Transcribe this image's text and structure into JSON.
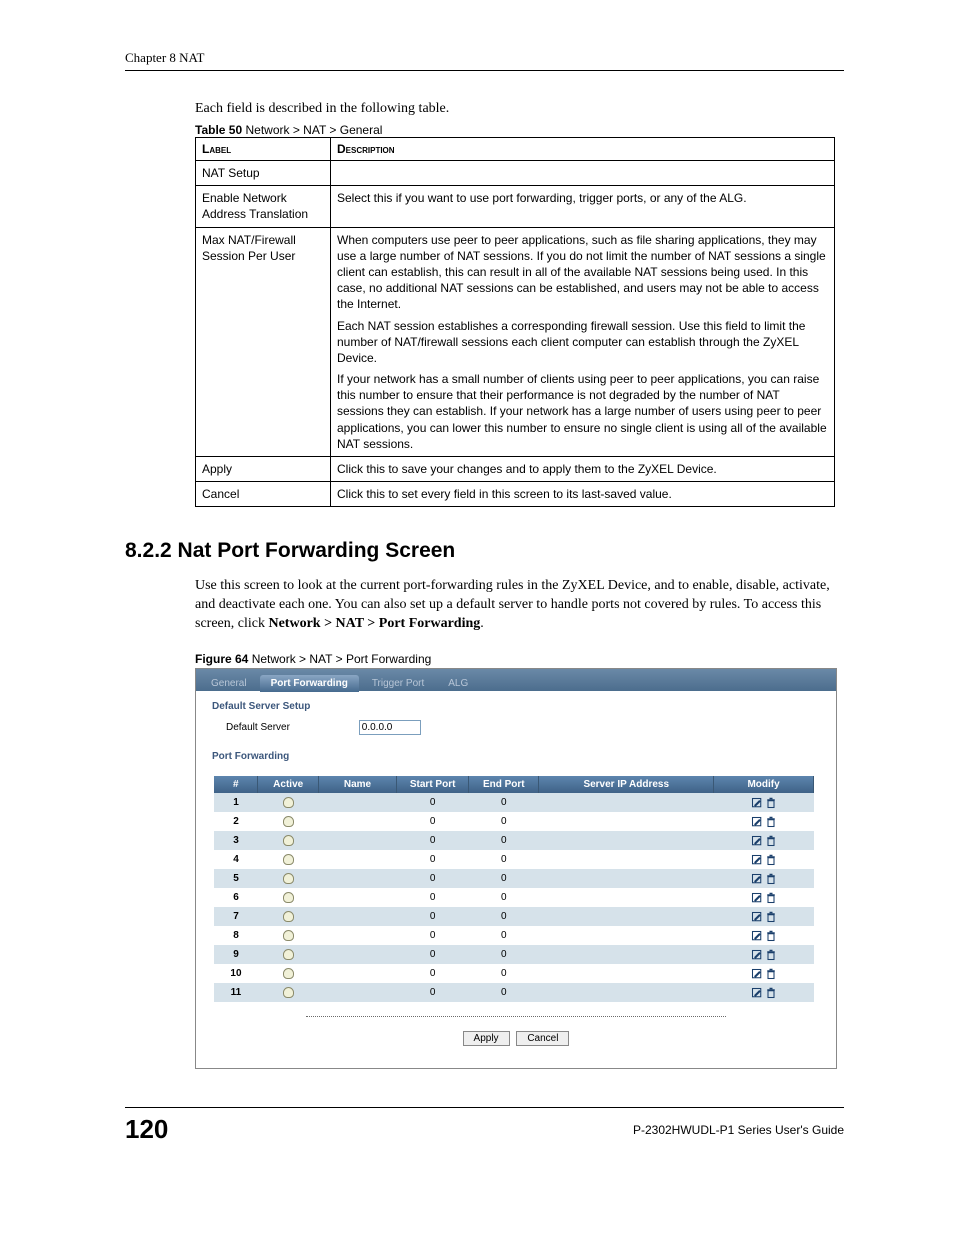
{
  "chapter_header": "Chapter 8 NAT",
  "intro": "Each field is described in the following table.",
  "table50": {
    "caption_bold": "Table 50",
    "caption_rest": "   Network > NAT > General",
    "head_label": "Label",
    "head_desc": "Description",
    "rows": [
      {
        "label": "NAT Setup",
        "desc": ""
      },
      {
        "label": "Enable Network Address Translation",
        "desc": "Select this if you want to use port forwarding, trigger ports, or any of the ALG."
      },
      {
        "label": "Max NAT/Firewall Session Per User",
        "p1": "When computers use peer to peer applications, such as file sharing applications, they may use a large number of NAT sessions. If you do not limit the number of NAT sessions a single client can establish, this can result in all of the available NAT sessions being used. In this case, no additional NAT sessions can be established, and users may not be able to access the Internet.",
        "p2": "Each NAT session establishes a corresponding firewall session. Use this field to limit the number of NAT/firewall sessions each client computer can establish through the ZyXEL Device.",
        "p3": "If your network has a small number of clients using peer to peer applications, you can raise this number to ensure that their performance is not degraded by the number of NAT sessions they can establish. If your network has a large number of users using peer to peer applications, you can lower this number to ensure no single client is using all of the available NAT sessions."
      },
      {
        "label": "Apply",
        "desc": "Click this to save your changes and to apply them to the ZyXEL Device."
      },
      {
        "label": "Cancel",
        "desc": "Click this to set every field in this screen to its last-saved value."
      }
    ]
  },
  "section_head": "8.2.2  Nat Port Forwarding Screen",
  "section_para_parts": {
    "t1": "Use this screen to look at the current port-forwarding rules in the ZyXEL Device, and to enable, disable, activate, and deactivate each one. You can also set up a default server to handle ports not covered by rules. To access this screen, click ",
    "b1": "Network > NAT > Port Forwarding",
    "t2": "."
  },
  "figure64": {
    "caption_bold": "Figure 64",
    "caption_rest": "   Network > NAT > Port Forwarding"
  },
  "tabs": {
    "general": "General",
    "port_forwarding": "Port Forwarding",
    "trigger_port": "Trigger Port",
    "alg": "ALG"
  },
  "default_server": {
    "heading": "Default Server Setup",
    "label": "Default Server",
    "value": "0.0.0.0"
  },
  "pf": {
    "heading": "Port Forwarding",
    "headers": {
      "num": "#",
      "active": "Active",
      "name": "Name",
      "start": "Start Port",
      "end": "End Port",
      "ip": "Server IP Address",
      "modify": "Modify"
    },
    "rows": [
      {
        "n": "1",
        "start": "0",
        "end": "0"
      },
      {
        "n": "2",
        "start": "0",
        "end": "0"
      },
      {
        "n": "3",
        "start": "0",
        "end": "0"
      },
      {
        "n": "4",
        "start": "0",
        "end": "0"
      },
      {
        "n": "5",
        "start": "0",
        "end": "0"
      },
      {
        "n": "6",
        "start": "0",
        "end": "0"
      },
      {
        "n": "7",
        "start": "0",
        "end": "0"
      },
      {
        "n": "8",
        "start": "0",
        "end": "0"
      },
      {
        "n": "9",
        "start": "0",
        "end": "0"
      },
      {
        "n": "10",
        "start": "0",
        "end": "0"
      },
      {
        "n": "11",
        "start": "0",
        "end": "0"
      }
    ]
  },
  "buttons": {
    "apply": "Apply",
    "cancel": "Cancel"
  },
  "footer": {
    "page": "120",
    "doc": "P-2302HWUDL-P1 Series User's Guide"
  }
}
